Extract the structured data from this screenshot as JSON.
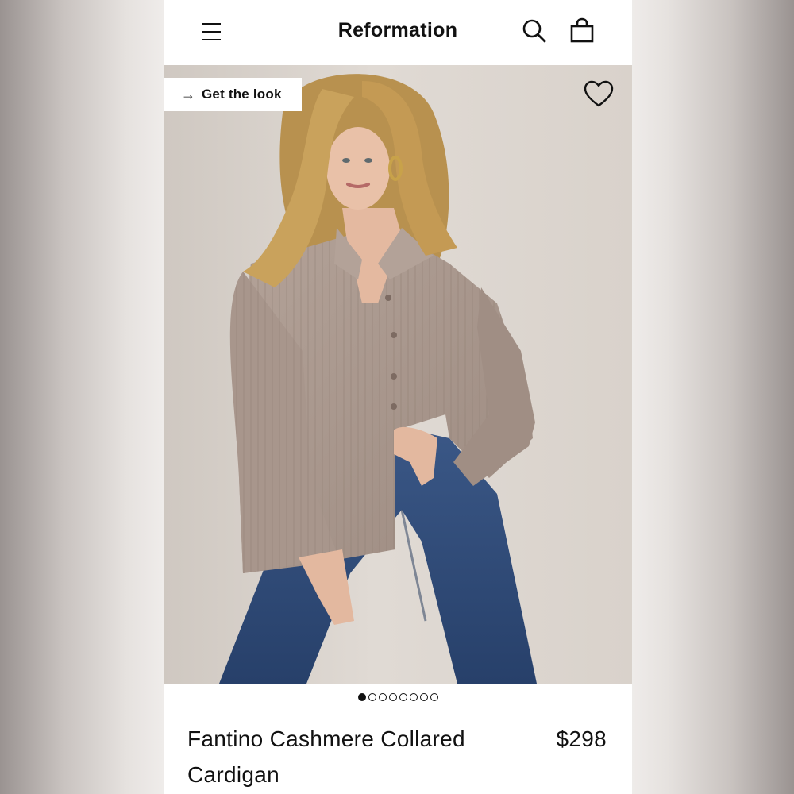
{
  "header": {
    "brand": "Reformation",
    "menu_icon": "hamburger-menu-icon",
    "search_icon": "search-icon",
    "bag_icon": "shopping-bag-icon"
  },
  "hero": {
    "get_the_look_label": "Get the look",
    "arrow_icon": "arrow-right-icon",
    "wishlist_icon": "heart-icon",
    "image_alt": "Model wearing taupe ribbed cashmere collared cardigan with blue jeans"
  },
  "carousel": {
    "total": 8,
    "active_index": 0
  },
  "product": {
    "name": "Fantino Cashmere Collared Cardigan",
    "price": "$298"
  },
  "colors": {
    "text": "#111111",
    "background": "#ffffff",
    "sweater": "#a8968c",
    "denim": "#2f4a74",
    "hair": "#c9a25c",
    "backdrop": "#ddd6cf"
  }
}
